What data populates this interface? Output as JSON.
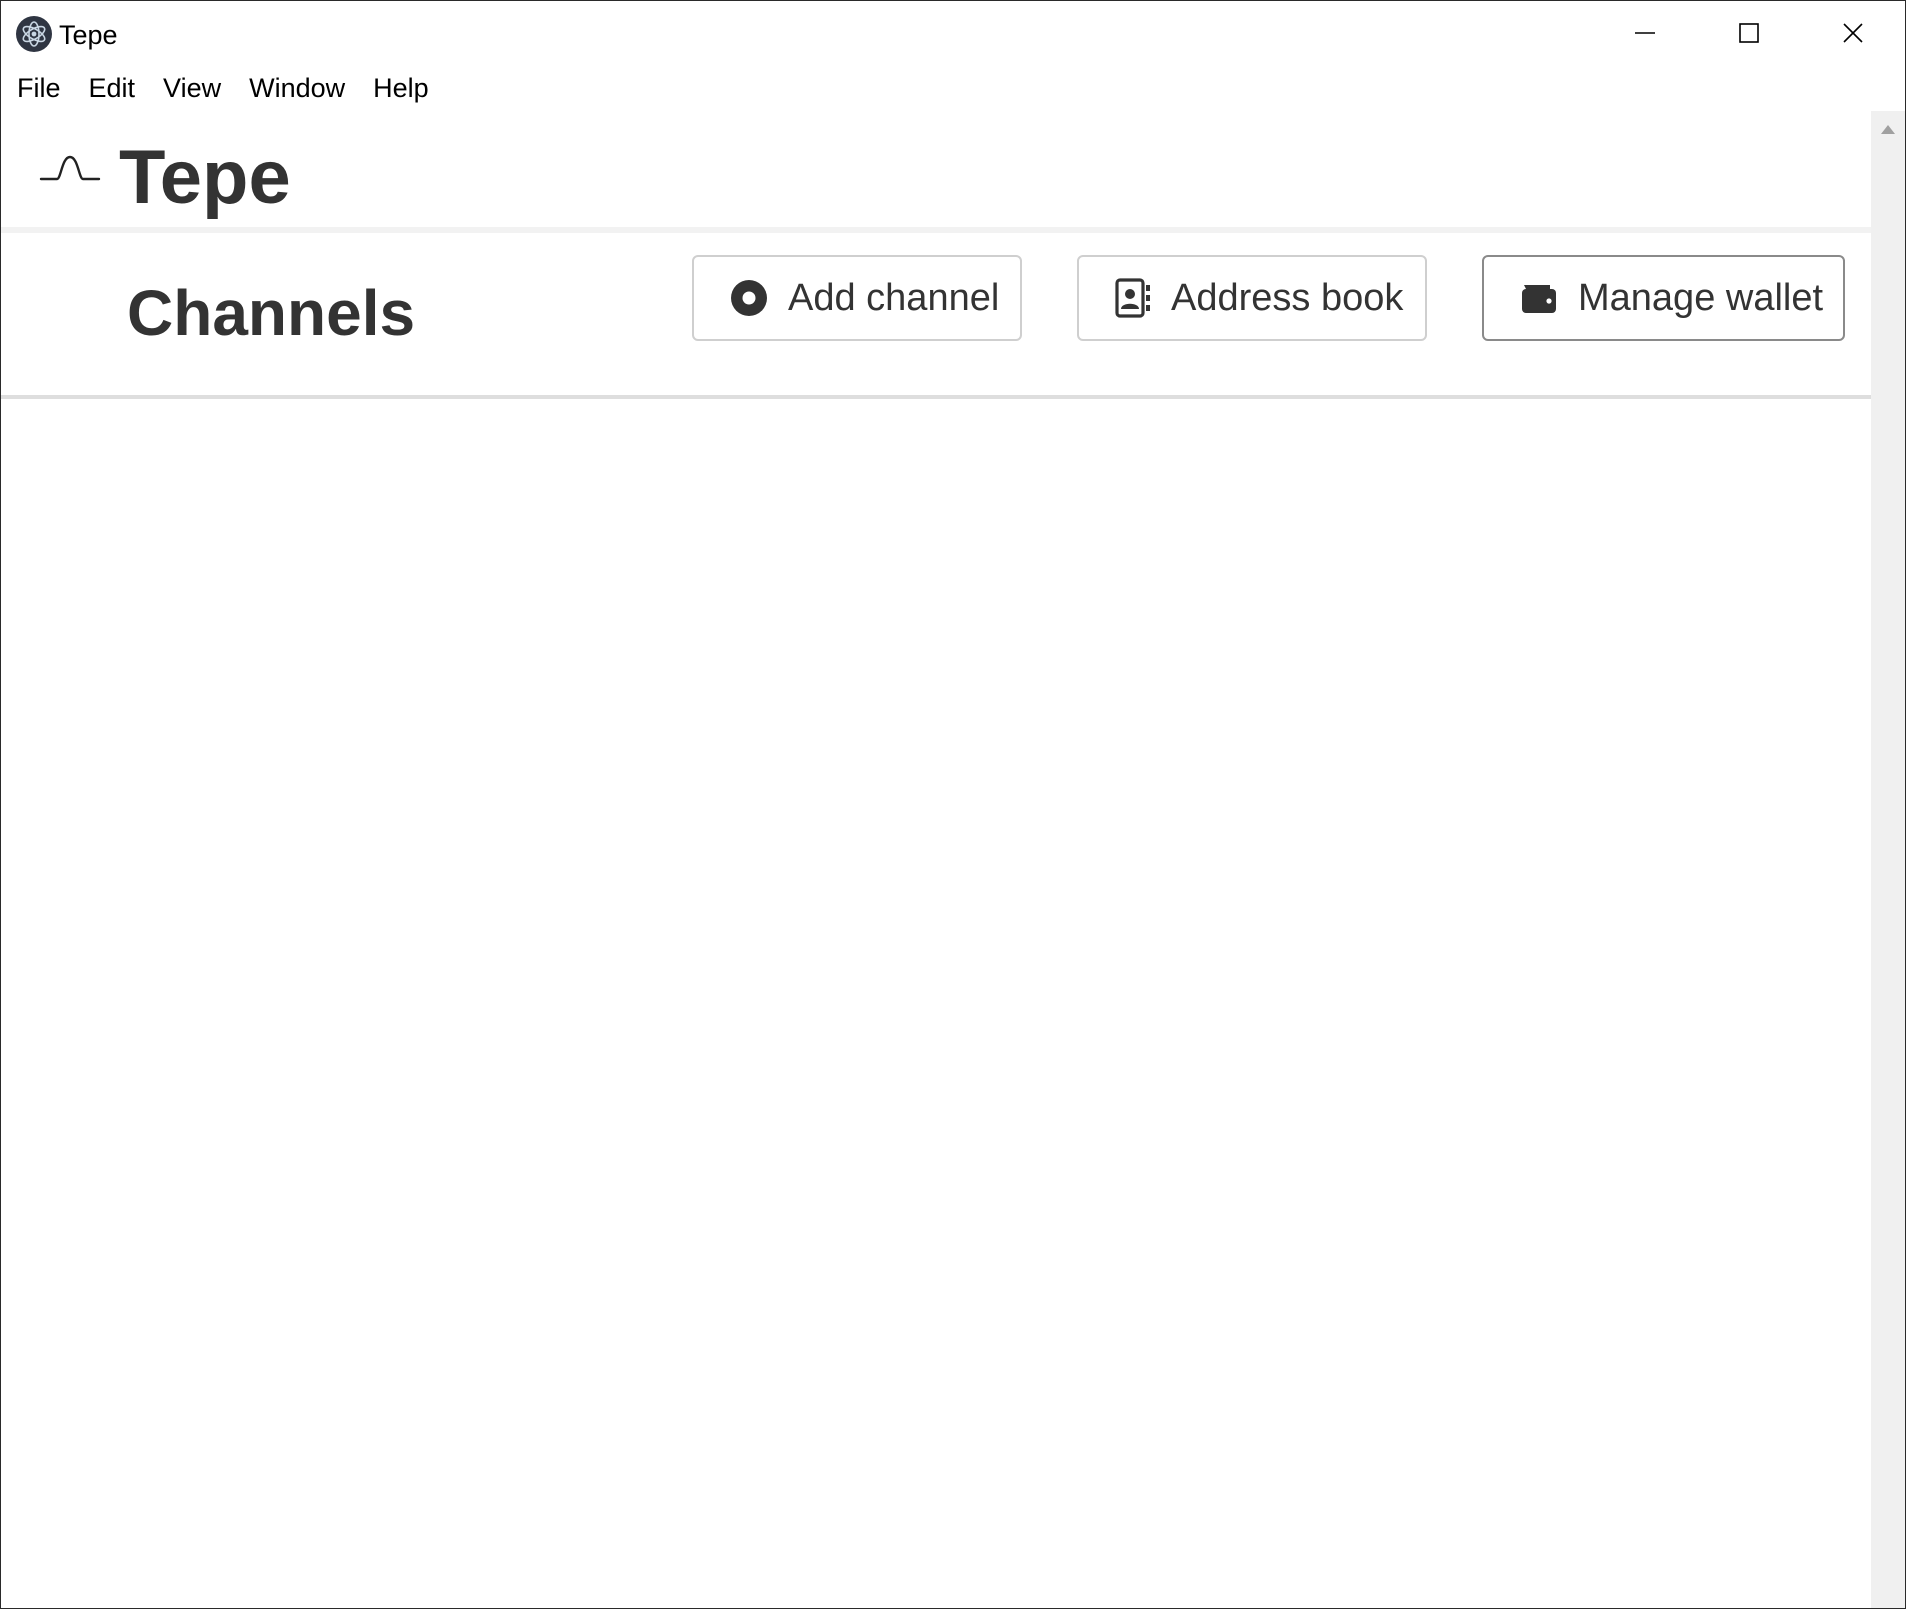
{
  "window": {
    "title": "Tepe"
  },
  "menu": {
    "items": [
      "File",
      "Edit",
      "View",
      "Window",
      "Help"
    ]
  },
  "header": {
    "brand": "Tepe",
    "brand_icon": "pulse-wave-icon"
  },
  "toolbar": {
    "section_title": "Channels",
    "add_channel_label": "Add channel",
    "address_book_label": "Address book",
    "manage_wallet_label": "Manage wallet"
  },
  "icons": {
    "app": "electron-app-icon",
    "add_channel": "record-circle-icon",
    "address_book": "contact-book-icon",
    "manage_wallet": "wallet-icon"
  },
  "colors": {
    "text": "#333333",
    "border": "#cfcfcf",
    "divider": "#dedede"
  }
}
